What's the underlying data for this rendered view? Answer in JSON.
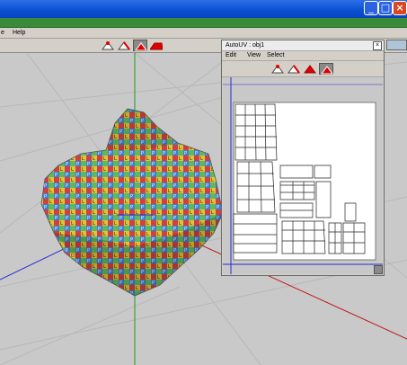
{
  "main_menu": {
    "partial_left": "e",
    "help": "Help"
  },
  "title_buttons": {
    "minimize": "_",
    "maximize": "□",
    "close": "×"
  },
  "toolbar": {
    "tools": [
      "vertex-mode",
      "edge-mode",
      "face-mode",
      "object-mode"
    ],
    "active_tool": "face-mode"
  },
  "viewport": {
    "object_name": "obj1",
    "mesh_palette": [
      "#d23f3f",
      "#3f7fd2",
      "#e0c33a",
      "#5fb85f",
      "#a05ad2",
      "#e08a3a",
      "#3fc7c7",
      "#d25fa0"
    ]
  },
  "uv_window": {
    "title": "AutoUV : obj1",
    "close": "×",
    "menu": {
      "edit": "Edit",
      "view": "View",
      "select": "Select"
    },
    "tools": [
      "vertex-mode",
      "edge-mode",
      "face-mode",
      "object-mode"
    ],
    "active_tool": "object-mode"
  },
  "colors": {
    "accent_red": "#e00000",
    "axis_green": "#1aa01a",
    "axis_blue": "#2a2ad0",
    "axis_red": "#c01818",
    "titlebar_blue": "#0a4fd1",
    "close_red": "#d9471f"
  }
}
